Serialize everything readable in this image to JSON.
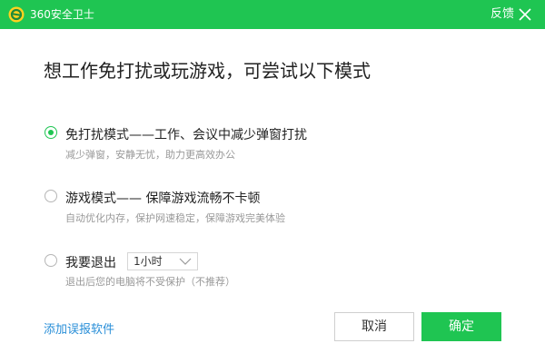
{
  "titlebar": {
    "app_title": "360安全卫士",
    "feedback_label": "反馈",
    "bg_color": "#1fc552",
    "icons": [
      "360-logo-icon",
      "close-icon"
    ]
  },
  "headline": "想工作免打扰或玩游戏，可尝试以下模式",
  "options": [
    {
      "title": "免打扰模式——工作、会议中减少弹窗打扰",
      "desc": "减少弹窗，安静无忧，助力更高效办公",
      "selected": true
    },
    {
      "title": "游戏模式—— 保障游戏流畅不卡顿",
      "desc": "自动优化内存，保护网速稳定，保障游戏完美体验",
      "selected": false
    },
    {
      "title": "我要退出",
      "desc": "退出后您的电脑将不受保护（不推荐）",
      "selected": false
    }
  ],
  "exit_duration": {
    "selected": "1小时"
  },
  "footer": {
    "add_false_report_link": "添加误报软件",
    "cancel_label": "取消",
    "ok_label": "确定"
  },
  "colors": {
    "accent": "#1fc552",
    "link": "#2a8fd8"
  }
}
